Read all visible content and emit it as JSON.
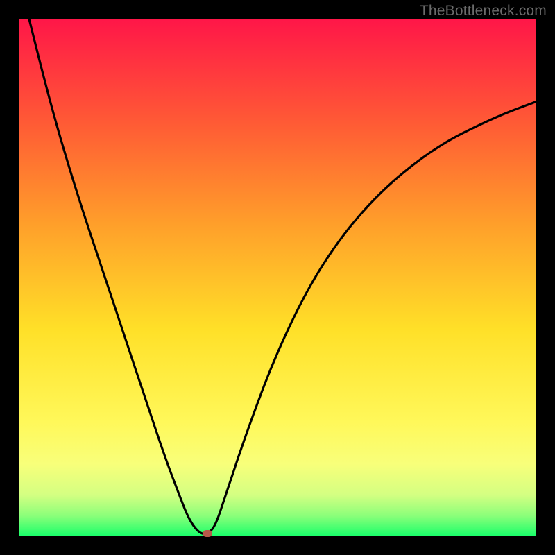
{
  "watermark": "TheBottleneck.com",
  "colors": {
    "frame_bg": "#000000",
    "curve_stroke": "#000000",
    "marker_fill": "#b65a4a",
    "gradient_stops": [
      {
        "offset": 0.0,
        "color": "#ff1648"
      },
      {
        "offset": 0.2,
        "color": "#ff5a35"
      },
      {
        "offset": 0.4,
        "color": "#ffa02a"
      },
      {
        "offset": 0.6,
        "color": "#ffe028"
      },
      {
        "offset": 0.78,
        "color": "#fff85a"
      },
      {
        "offset": 0.86,
        "color": "#f8ff7a"
      },
      {
        "offset": 0.92,
        "color": "#d4ff82"
      },
      {
        "offset": 0.96,
        "color": "#8cff7a"
      },
      {
        "offset": 1.0,
        "color": "#18ff6a"
      }
    ]
  },
  "chart_data": {
    "type": "line",
    "title": "",
    "xlabel": "",
    "ylabel": "",
    "xlim": [
      0,
      100
    ],
    "ylim": [
      0,
      100
    ],
    "grid": false,
    "legend": false,
    "series": [
      {
        "name": "bottleneck-curve",
        "x": [
          2,
          5,
          8,
          12,
          16,
          20,
          24,
          28,
          31,
          33,
          35,
          36.5,
          38,
          40,
          44,
          50,
          58,
          68,
          80,
          92,
          100
        ],
        "y": [
          100,
          88,
          77,
          64,
          52,
          40,
          28,
          16,
          8,
          3,
          0.5,
          0.5,
          2,
          8,
          20,
          36,
          52,
          65,
          75,
          81,
          84
        ]
      }
    ],
    "marker": {
      "x": 36.5,
      "y": 0.6
    }
  }
}
